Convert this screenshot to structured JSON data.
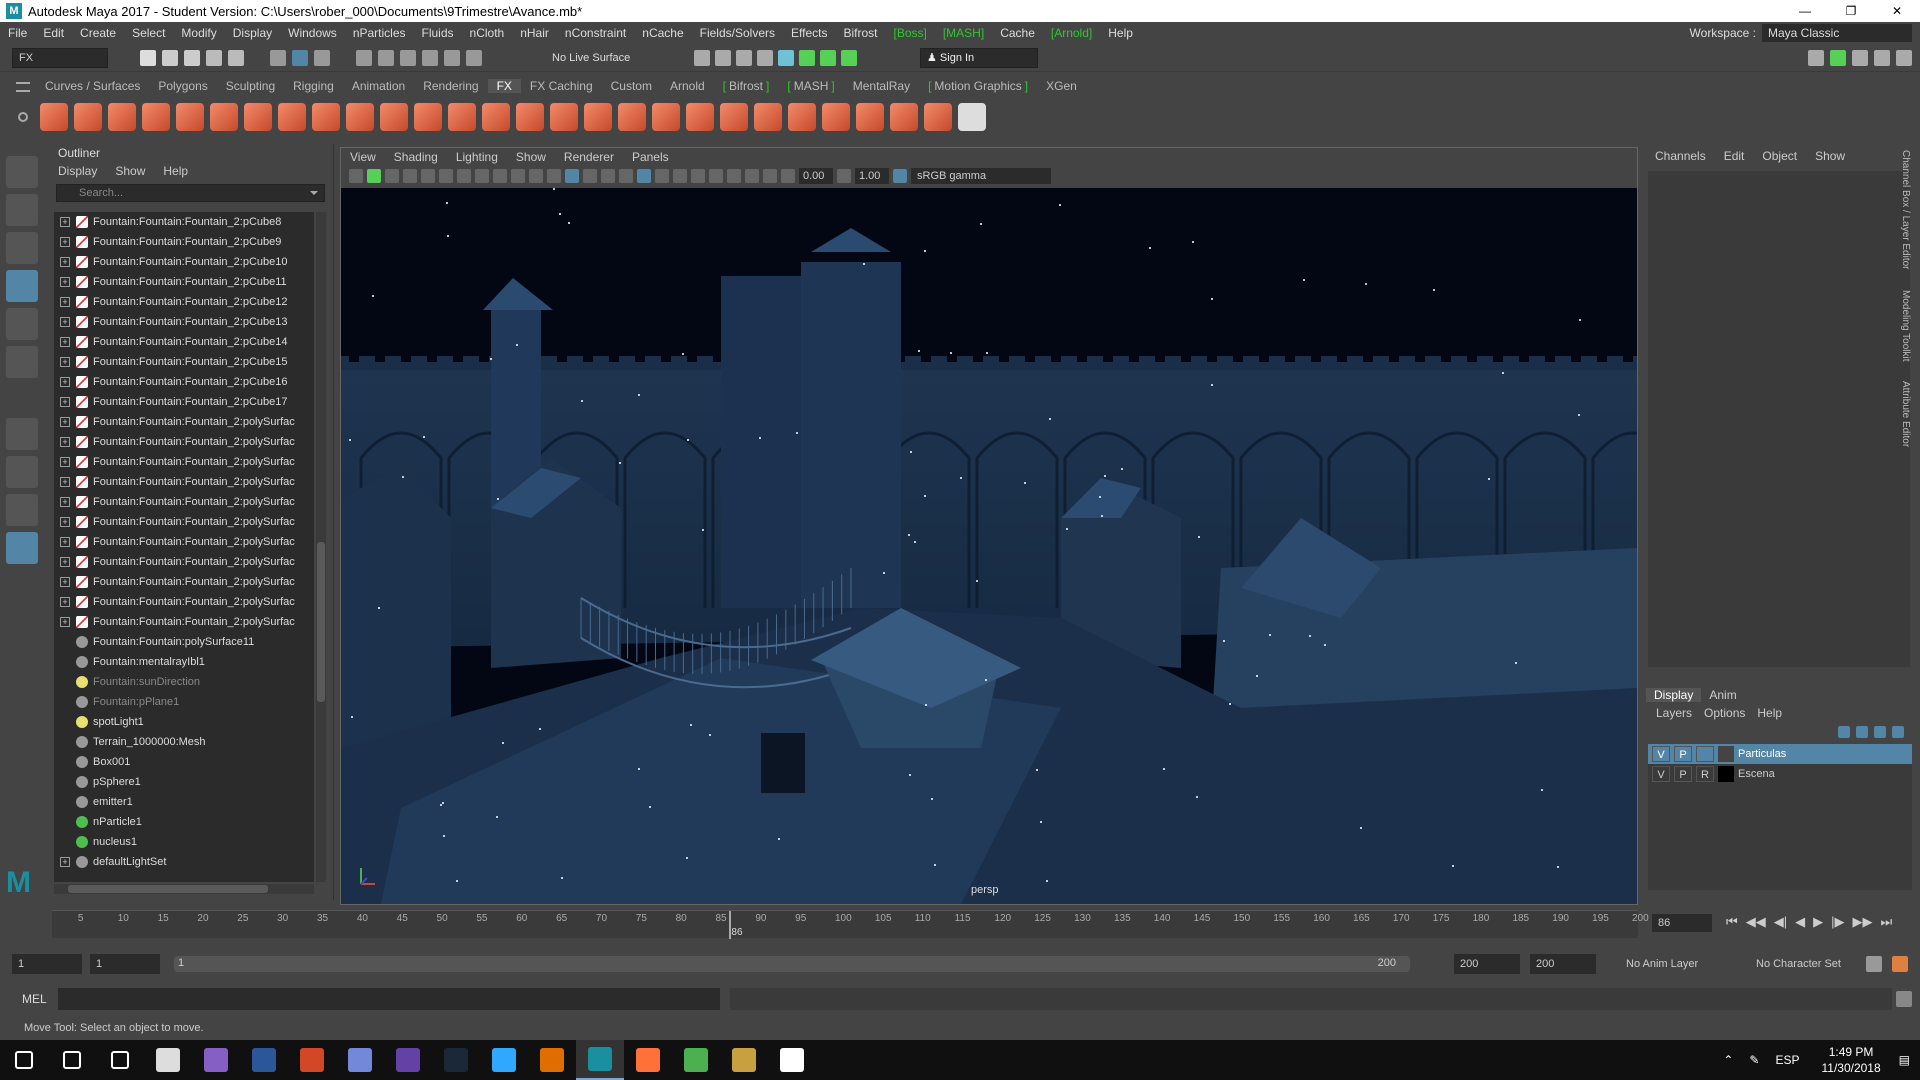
{
  "window": {
    "title": "Autodesk Maya 2017 - Student Version: C:\\Users\\rober_000\\Documents\\9Trimestre\\Avance.mb*",
    "logo": "M"
  },
  "menubar": {
    "items": [
      {
        "label": "File"
      },
      {
        "label": "Edit"
      },
      {
        "label": "Create"
      },
      {
        "label": "Select"
      },
      {
        "label": "Modify"
      },
      {
        "label": "Display"
      },
      {
        "label": "Windows"
      },
      {
        "label": "nParticles"
      },
      {
        "label": "Fluids"
      },
      {
        "label": "nCloth"
      },
      {
        "label": "nHair"
      },
      {
        "label": "nConstraint"
      },
      {
        "label": "nCache"
      },
      {
        "label": "Fields/Solvers"
      },
      {
        "label": "Effects"
      },
      {
        "label": "Bifrost"
      },
      {
        "label": "[Boss]"
      },
      {
        "label": "[MASH]"
      },
      {
        "label": "Cache"
      },
      {
        "label": "[Arnold]"
      },
      {
        "label": "Help"
      }
    ],
    "workspace_label": "Workspace :",
    "workspace_value": "Maya Classic"
  },
  "statusline": {
    "menuset": "FX",
    "live_surface": "No Live Surface",
    "sign_in": "Sign In"
  },
  "shelf": {
    "tabs": [
      {
        "label": "Curves / Surfaces",
        "bracket": false
      },
      {
        "label": "Polygons",
        "bracket": false
      },
      {
        "label": "Sculpting",
        "bracket": false
      },
      {
        "label": "Rigging",
        "bracket": false
      },
      {
        "label": "Animation",
        "bracket": false
      },
      {
        "label": "Rendering",
        "bracket": false
      },
      {
        "label": "FX",
        "bracket": false,
        "active": true
      },
      {
        "label": "FX Caching",
        "bracket": false
      },
      {
        "label": "Custom",
        "bracket": false
      },
      {
        "label": "Arnold",
        "bracket": false
      },
      {
        "label": "Bifrost",
        "bracket": true
      },
      {
        "label": "MASH",
        "bracket": true
      },
      {
        "label": "MentalRay",
        "bracket": false
      },
      {
        "label": "Motion Graphics",
        "bracket": true
      },
      {
        "label": "XGen",
        "bracket": false
      }
    ],
    "icon_count": 28
  },
  "outliner": {
    "title": "Outliner",
    "menu": [
      "Display",
      "Show",
      "Help"
    ],
    "search_placeholder": "Search...",
    "rows": [
      {
        "label": "Fountain:Fountain:Fountain_2:pCube8",
        "icon": "mesh",
        "expand": true
      },
      {
        "label": "Fountain:Fountain:Fountain_2:pCube9",
        "icon": "mesh",
        "expand": true
      },
      {
        "label": "Fountain:Fountain:Fountain_2:pCube10",
        "icon": "mesh",
        "expand": true
      },
      {
        "label": "Fountain:Fountain:Fountain_2:pCube11",
        "icon": "mesh",
        "expand": true
      },
      {
        "label": "Fountain:Fountain:Fountain_2:pCube12",
        "icon": "mesh",
        "expand": true
      },
      {
        "label": "Fountain:Fountain:Fountain_2:pCube13",
        "icon": "mesh",
        "expand": true
      },
      {
        "label": "Fountain:Fountain:Fountain_2:pCube14",
        "icon": "mesh",
        "expand": true
      },
      {
        "label": "Fountain:Fountain:Fountain_2:pCube15",
        "icon": "mesh",
        "expand": true
      },
      {
        "label": "Fountain:Fountain:Fountain_2:pCube16",
        "icon": "mesh",
        "expand": true
      },
      {
        "label": "Fountain:Fountain:Fountain_2:pCube17",
        "icon": "mesh",
        "expand": true
      },
      {
        "label": "Fountain:Fountain:Fountain_2:polySurfac",
        "icon": "mesh",
        "expand": true
      },
      {
        "label": "Fountain:Fountain:Fountain_2:polySurfac",
        "icon": "mesh",
        "expand": true
      },
      {
        "label": "Fountain:Fountain:Fountain_2:polySurfac",
        "icon": "mesh",
        "expand": true
      },
      {
        "label": "Fountain:Fountain:Fountain_2:polySurfac",
        "icon": "mesh",
        "expand": true
      },
      {
        "label": "Fountain:Fountain:Fountain_2:polySurfac",
        "icon": "mesh",
        "expand": true
      },
      {
        "label": "Fountain:Fountain:Fountain_2:polySurfac",
        "icon": "mesh",
        "expand": true
      },
      {
        "label": "Fountain:Fountain:Fountain_2:polySurfac",
        "icon": "mesh",
        "expand": true
      },
      {
        "label": "Fountain:Fountain:Fountain_2:polySurfac",
        "icon": "mesh",
        "expand": true
      },
      {
        "label": "Fountain:Fountain:Fountain_2:polySurfac",
        "icon": "mesh",
        "expand": true
      },
      {
        "label": "Fountain:Fountain:Fountain_2:polySurfac",
        "icon": "mesh",
        "expand": true
      },
      {
        "label": "Fountain:Fountain:Fountain_2:polySurfac",
        "icon": "mesh",
        "expand": true
      },
      {
        "label": "Fountain:Fountain:polySurface11",
        "icon": "grp",
        "expand": false
      },
      {
        "label": "Fountain:mentalrayIbl1",
        "icon": "grp",
        "expand": false
      },
      {
        "label": "Fountain:sunDirection",
        "icon": "light",
        "expand": false,
        "dim": true
      },
      {
        "label": "Fountain:pPlane1",
        "icon": "grp",
        "expand": false,
        "dim": true
      },
      {
        "label": "spotLight1",
        "icon": "light",
        "expand": false
      },
      {
        "label": "Terrain_1000000:Mesh",
        "icon": "grp",
        "expand": false
      },
      {
        "label": "Box001",
        "icon": "grp",
        "expand": false
      },
      {
        "label": "pSphere1",
        "icon": "grp",
        "expand": false
      },
      {
        "label": "emitter1",
        "icon": "grp",
        "expand": false
      },
      {
        "label": "nParticle1",
        "icon": "green",
        "expand": false
      },
      {
        "label": "nucleus1",
        "icon": "green",
        "expand": false
      },
      {
        "label": "defaultLightSet",
        "icon": "grp",
        "expand": true
      }
    ]
  },
  "viewport": {
    "menu": [
      "View",
      "Shading",
      "Lighting",
      "Show",
      "Renderer",
      "Panels"
    ],
    "exposure": "0.00",
    "gamma": "1.00",
    "color_space": "sRGB gamma",
    "camera": "persp"
  },
  "channelbox": {
    "menu": [
      "Channels",
      "Edit",
      "Object",
      "Show"
    ]
  },
  "layer_editor": {
    "tabs": [
      "Display",
      "Anim"
    ],
    "menu": [
      "Layers",
      "Options",
      "Help"
    ],
    "layers": [
      {
        "v": "V",
        "p": "P",
        "r": "",
        "name": "Particulas",
        "selected": true,
        "color": "#444444"
      },
      {
        "v": "V",
        "p": "P",
        "r": "R",
        "name": "Escena",
        "selected": false,
        "color": "#000000"
      }
    ]
  },
  "side_tabs": [
    "Channel Box / Layer Editor",
    "Modeling Toolkit",
    "Attribute Editor"
  ],
  "timeline": {
    "ticks": [
      "5",
      "10",
      "15",
      "20",
      "25",
      "30",
      "35",
      "40",
      "45",
      "50",
      "55",
      "60",
      "65",
      "70",
      "75",
      "80",
      "85",
      "90",
      "95",
      "100",
      "105",
      "110",
      "115",
      "120",
      "125",
      "130",
      "135",
      "140",
      "145",
      "150",
      "155",
      "160",
      "165",
      "170",
      "175",
      "180",
      "185",
      "190",
      "195",
      "200"
    ],
    "current": "86",
    "current_frame_field": "86",
    "current_value": 86,
    "start": 1,
    "end": 200
  },
  "range": {
    "start": "1",
    "start2": "1",
    "slider_left": "1",
    "slider_right": "200",
    "end": "200",
    "end2": "200",
    "anim_layer": "No Anim Layer",
    "char_set": "No Character Set"
  },
  "command": {
    "label": "MEL"
  },
  "help_line": "Move Tool: Select an object to move.",
  "taskbar": {
    "apps": [
      {
        "name": "start-icon",
        "color": "#ffffff"
      },
      {
        "name": "search-icon",
        "color": "#ffffff"
      },
      {
        "name": "task-view-icon",
        "color": "#ffffff"
      },
      {
        "name": "7zip-icon",
        "color": "#dddddd"
      },
      {
        "name": "visual-studio-icon",
        "color": "#865fc5"
      },
      {
        "name": "word-icon",
        "color": "#2b579a"
      },
      {
        "name": "powerpoint-icon",
        "color": "#d24726"
      },
      {
        "name": "discord-icon",
        "color": "#7289da"
      },
      {
        "name": "twitch-icon",
        "color": "#6441a5"
      },
      {
        "name": "steam-icon",
        "color": "#1b2838"
      },
      {
        "name": "photoshop-icon",
        "color": "#31a8ff"
      },
      {
        "name": "orange-app-icon",
        "color": "#e06d00"
      },
      {
        "name": "maya-icon",
        "color": "#1a8fa0",
        "active": true
      },
      {
        "name": "firefox-icon",
        "color": "#ff7139"
      },
      {
        "name": "chrome-icon",
        "color": "#4caf50"
      },
      {
        "name": "winrar-icon",
        "color": "#c8a040"
      },
      {
        "name": "obs-icon",
        "color": "#ffffff"
      }
    ],
    "lang": "ESP",
    "time": "1:49 PM",
    "date": "11/30/2018"
  }
}
